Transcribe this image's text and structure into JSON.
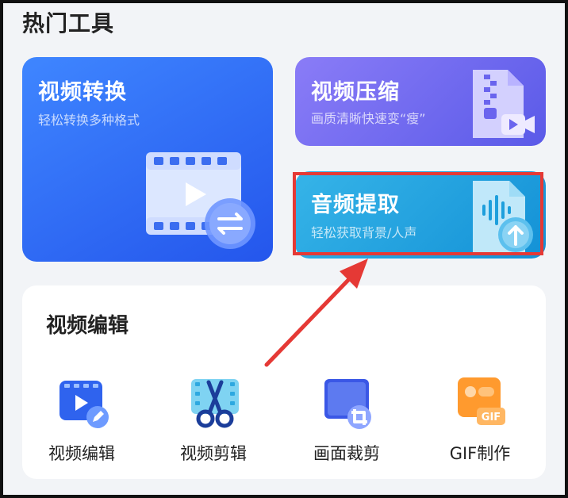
{
  "section": {
    "title": "热门工具"
  },
  "cards": {
    "convert": {
      "title": "视频转换",
      "subtitle": "轻松转换多种格式"
    },
    "compress": {
      "title": "视频压缩",
      "subtitle": "画质清晰快速变“瘦”"
    },
    "audio": {
      "title": "音频提取",
      "subtitle": "轻松获取背景/人声"
    }
  },
  "edit_panel": {
    "title": "视频编辑",
    "tools": [
      {
        "label": "视频编辑",
        "icon": "video-edit-icon"
      },
      {
        "label": "视频剪辑",
        "icon": "scissors-icon"
      },
      {
        "label": "画面裁剪",
        "icon": "crop-icon"
      },
      {
        "label": "GIF制作",
        "icon": "gif-icon"
      }
    ],
    "gif_badge": "GIF"
  },
  "colors": {
    "convert_card": "#2456ec",
    "compress_card": "#6a64ee",
    "audio_card": "#1e9fdc",
    "highlight": "#e53935"
  }
}
